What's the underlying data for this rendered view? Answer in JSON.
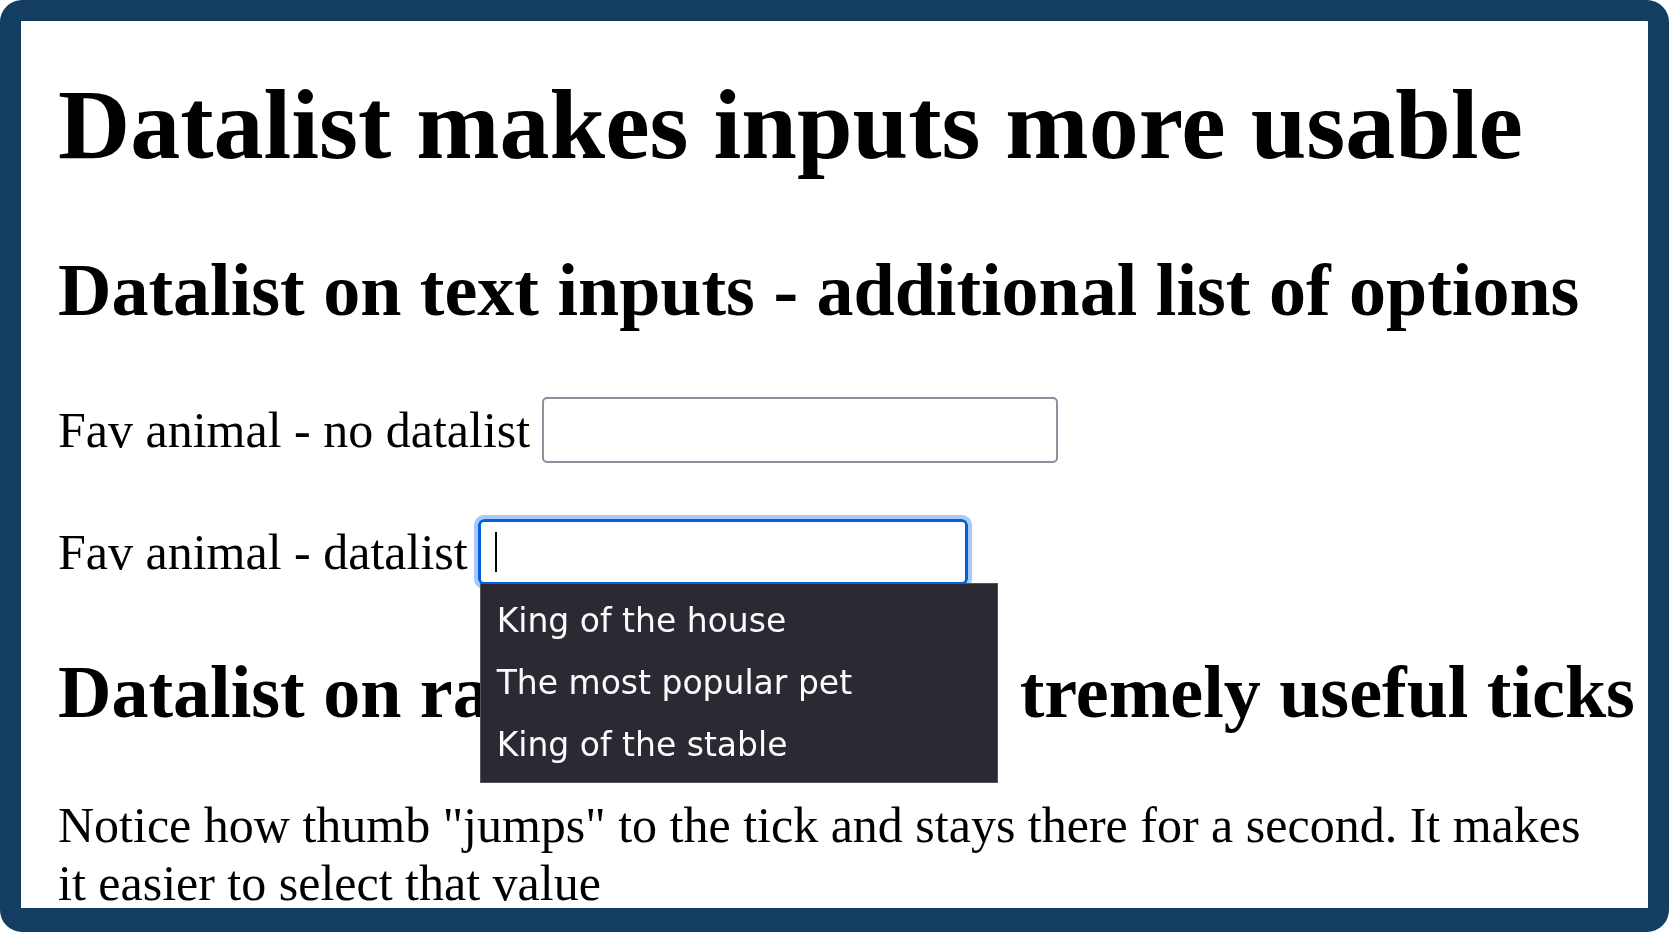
{
  "title": "Datalist makes inputs more usable",
  "sections": [
    {
      "heading": "Datalist on text inputs - additional list of options",
      "fields": [
        {
          "label": "Fav animal - no datalist",
          "focused": false
        },
        {
          "label": "Fav animal - datalist",
          "focused": true,
          "options": [
            "King of the house",
            "The most popular pet",
            "King of the stable"
          ]
        }
      ]
    },
    {
      "heading_parts": [
        "Datalist on ra",
        "tremely useful ticks"
      ],
      "paragraph": "Notice how thumb \"jumps\" to the tick and stays there for a second. It makes it easier to select that value"
    }
  ]
}
